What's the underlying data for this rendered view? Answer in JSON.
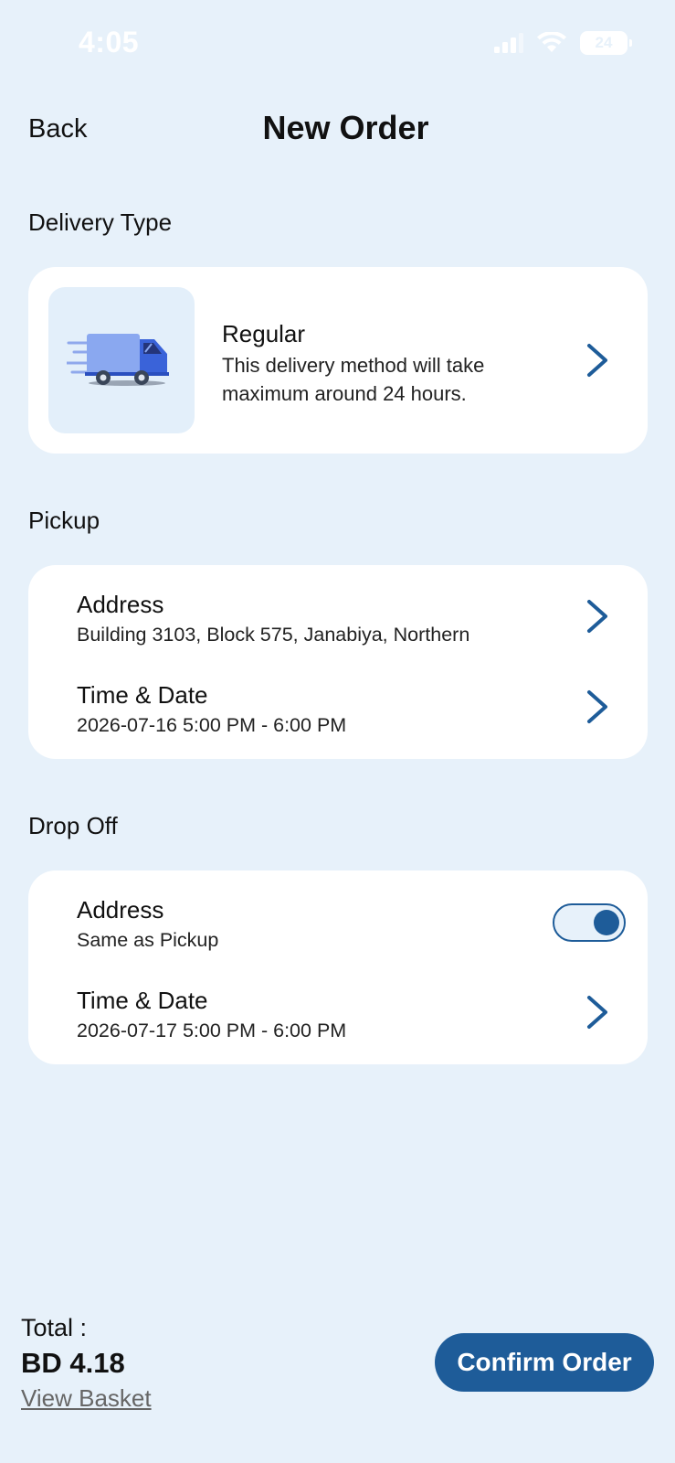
{
  "status_bar": {
    "time": "4:05",
    "battery": "24",
    "icons": [
      "cellular-signal-icon",
      "wifi-icon",
      "battery-icon"
    ]
  },
  "header": {
    "back_label": "Back",
    "title": "New Order"
  },
  "delivery_type": {
    "section_label": "Delivery Type",
    "title": "Regular",
    "description": "This delivery method will take maximum around 24 hours.",
    "icon": "delivery-truck-icon"
  },
  "pickup": {
    "section_label": "Pickup",
    "address_title": "Address",
    "address_value": "Building 3103, Block 575, Janabiya, Northern",
    "time_title": "Time & Date",
    "time_value": "2026-07-16 5:00 PM - 6:00 PM"
  },
  "dropoff": {
    "section_label": "Drop Off",
    "address_title": "Address",
    "address_value": "Same as Pickup",
    "same_as_pickup_on": true,
    "time_title": "Time & Date",
    "time_value": "2026-07-17 5:00 PM - 6:00 PM"
  },
  "footer": {
    "total_label": "Total :",
    "total_value": "BD 4.18",
    "view_basket_label": "View Basket",
    "confirm_label": "Confirm Order"
  },
  "colors": {
    "background": "#e7f1fa",
    "accent": "#1e5c99",
    "card": "#ffffff"
  }
}
